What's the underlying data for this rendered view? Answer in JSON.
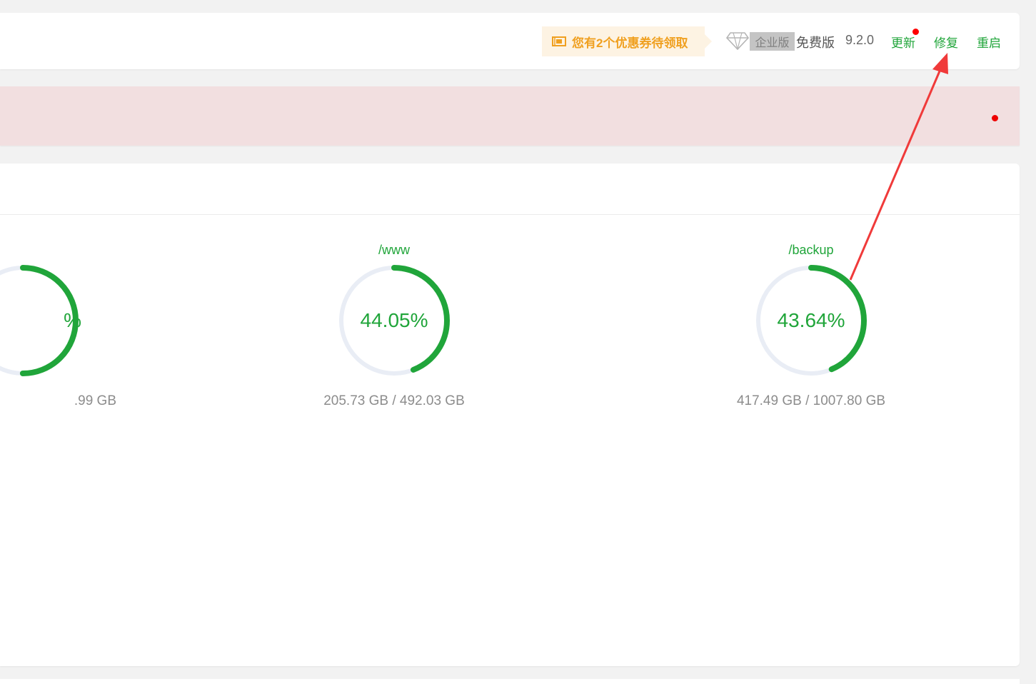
{
  "topbar": {
    "coupon_text": "您有2个优惠券待领取",
    "enterprise_label": "企业版",
    "edition": "免费版",
    "version": "9.2.0",
    "update_label": "更新",
    "repair_label": "修复",
    "restart_label": "重启"
  },
  "disks": [
    {
      "path": "",
      "percent_label": "%",
      "percent": 0.5,
      "size": ".99 GB"
    },
    {
      "path": "/www",
      "percent_label": "44.05%",
      "percent": 0.4405,
      "size": "205.73 GB / 492.03 GB"
    },
    {
      "path": "/backup",
      "percent_label": "43.64%",
      "percent": 0.4364,
      "size": "417.49 GB / 1007.80 GB"
    }
  ],
  "colors": {
    "accent": "#20a53a",
    "track": "#e9edf5",
    "alert_bg": "#f2dfe0",
    "annotation": "#f03a3a"
  },
  "icons": {
    "coupon": "ticket-icon",
    "edition": "diamond-icon"
  }
}
